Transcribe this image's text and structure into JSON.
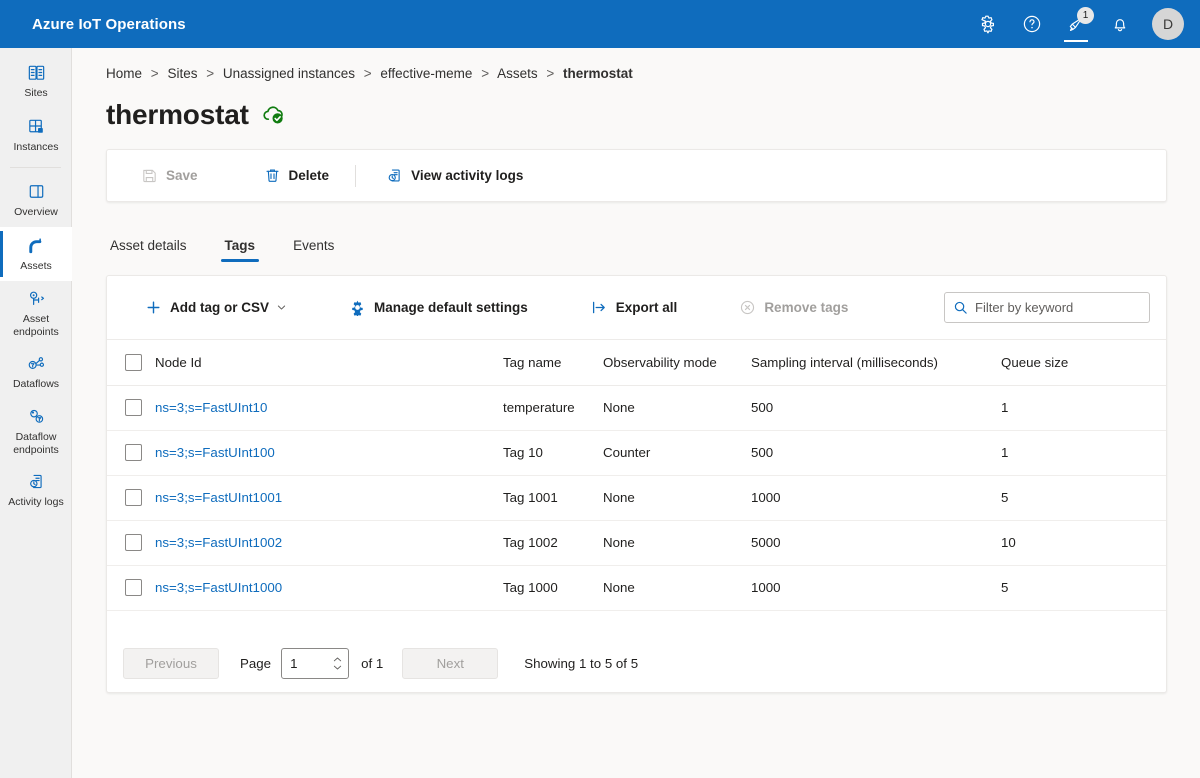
{
  "app": {
    "title": "Azure IoT Operations",
    "brand_color": "#0f6cbd",
    "link_color": "#0f6cbd",
    "status_color": "#107c10"
  },
  "topbar": {
    "icons": [
      {
        "name": "settings-icon",
        "glyph": "gear"
      },
      {
        "name": "help-icon",
        "glyph": "question-circle"
      },
      {
        "name": "feedback-icon",
        "glyph": "megaphone",
        "badge": "1"
      },
      {
        "name": "notifications-icon",
        "glyph": "bell"
      }
    ],
    "avatar_initial": "D"
  },
  "sidebar": {
    "items": [
      {
        "label": "Sites",
        "icon": "sites-icon",
        "selected": false
      },
      {
        "label": "Instances",
        "icon": "instances-icon",
        "selected": false
      },
      {
        "label": "Overview",
        "icon": "overview-icon",
        "selected": false
      },
      {
        "label": "Assets",
        "icon": "assets-icon",
        "selected": true
      },
      {
        "label": "Asset endpoints",
        "icon": "asset-endpoints-icon",
        "selected": false
      },
      {
        "label": "Dataflows",
        "icon": "dataflows-icon",
        "selected": false
      },
      {
        "label": "Dataflow endpoints",
        "icon": "dataflow-endpoints-icon",
        "selected": false
      },
      {
        "label": "Activity logs",
        "icon": "activity-logs-icon",
        "selected": false
      }
    ]
  },
  "breadcrumb": {
    "separator": ">",
    "items": [
      {
        "label": "Home"
      },
      {
        "label": "Sites"
      },
      {
        "label": "Unassigned instances"
      },
      {
        "label": "effective-meme"
      },
      {
        "label": "Assets"
      },
      {
        "label": "thermostat"
      }
    ]
  },
  "page": {
    "title": "thermostat",
    "status_icon": "cloud-check-icon"
  },
  "command_bar": {
    "save": {
      "label": "Save",
      "icon": "save-icon",
      "disabled": true
    },
    "delete": {
      "label": "Delete",
      "icon": "trash-icon",
      "disabled": false
    },
    "activity_logs": {
      "label": "View activity logs",
      "icon": "activity-logs-icon",
      "disabled": false
    }
  },
  "tabs": [
    {
      "label": "Asset details",
      "active": false
    },
    {
      "label": "Tags",
      "active": true
    },
    {
      "label": "Events",
      "active": false
    }
  ],
  "table_toolbar": {
    "add_tag": {
      "label": "Add tag or CSV",
      "icon": "plus-icon",
      "caret": true
    },
    "manage_defaults": {
      "label": "Manage default settings",
      "icon": "gear-icon"
    },
    "export_all": {
      "label": "Export all",
      "icon": "export-icon"
    },
    "remove_tags": {
      "label": "Remove tags",
      "icon": "remove-circle-icon",
      "disabled": true
    },
    "filter": {
      "placeholder": "Filter by keyword",
      "value": "",
      "icon": "search-icon"
    }
  },
  "table": {
    "columns": [
      "Node Id",
      "Tag name",
      "Observability mode",
      "Sampling interval (milliseconds)",
      "Queue size"
    ],
    "rows": [
      {
        "node_id": "ns=3;s=FastUInt10",
        "tag_name": "temperature",
        "observability_mode": "None",
        "sampling_interval": "500",
        "queue_size": "1",
        "checked": false
      },
      {
        "node_id": "ns=3;s=FastUInt100",
        "tag_name": "Tag 10",
        "observability_mode": "Counter",
        "sampling_interval": "500",
        "queue_size": "1",
        "checked": false
      },
      {
        "node_id": "ns=3;s=FastUInt1001",
        "tag_name": "Tag 1001",
        "observability_mode": "None",
        "sampling_interval": "1000",
        "queue_size": "5",
        "checked": false
      },
      {
        "node_id": "ns=3;s=FastUInt1002",
        "tag_name": "Tag 1002",
        "observability_mode": "None",
        "sampling_interval": "5000",
        "queue_size": "10",
        "checked": false
      },
      {
        "node_id": "ns=3;s=FastUInt1000",
        "tag_name": "Tag 1000",
        "observability_mode": "None",
        "sampling_interval": "1000",
        "queue_size": "5",
        "checked": false
      }
    ]
  },
  "pagination": {
    "previous_label": "Previous",
    "previous_disabled": true,
    "page_label": "Page",
    "page_value": "1",
    "of_label": "of 1",
    "next_label": "Next",
    "next_disabled": true,
    "showing": "Showing 1 to 5 of 5"
  }
}
